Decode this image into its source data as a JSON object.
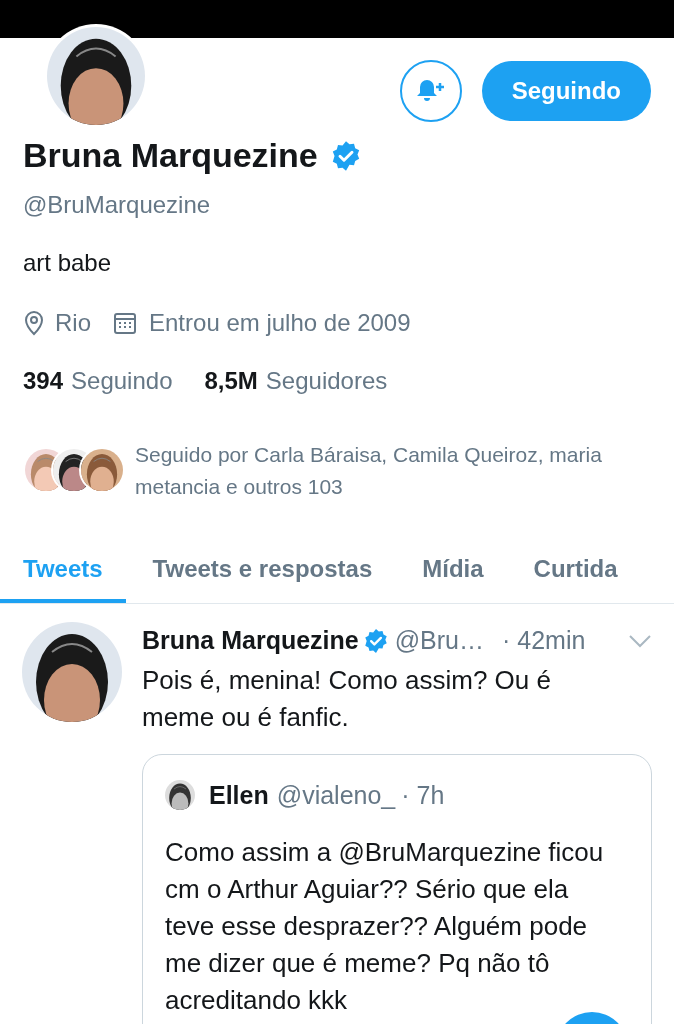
{
  "profile": {
    "name": "Bruna Marquezine",
    "verified": true,
    "handle": "@BruMarquezine",
    "bio": "art babe",
    "location": "Rio",
    "joined": "Entrou em julho de 2009",
    "following_count": "394",
    "following_label": "Seguindo",
    "followers_count": "8,5M",
    "followers_label": "Seguidores",
    "followed_by": "Seguido por Carla Báraisa, Camila Queiroz, maria metancia e outros 103",
    "follow_button": "Seguindo"
  },
  "tabs": [
    {
      "label": "Tweets",
      "selected": true
    },
    {
      "label": "Tweets e respostas",
      "selected": false
    },
    {
      "label": "Mídia",
      "selected": false
    },
    {
      "label": "Curtida",
      "selected": false
    }
  ],
  "tweet": {
    "author": "Bruna Marquezine",
    "verified": true,
    "handle": "@Bru…",
    "time": "· 42min",
    "text": "Pois é, menina! Como assim? Ou é meme ou é fanfic.",
    "quote": {
      "author": "Ellen",
      "handle": "@vialeno_",
      "time": "· 7h",
      "text": "Como assim a @BruMarquezine ficou cm o Arthur Aguiar?? Sério que ela teve esse desprazer?? Alguém pode me dizer que é meme? Pq não tô acreditando kkk"
    }
  }
}
